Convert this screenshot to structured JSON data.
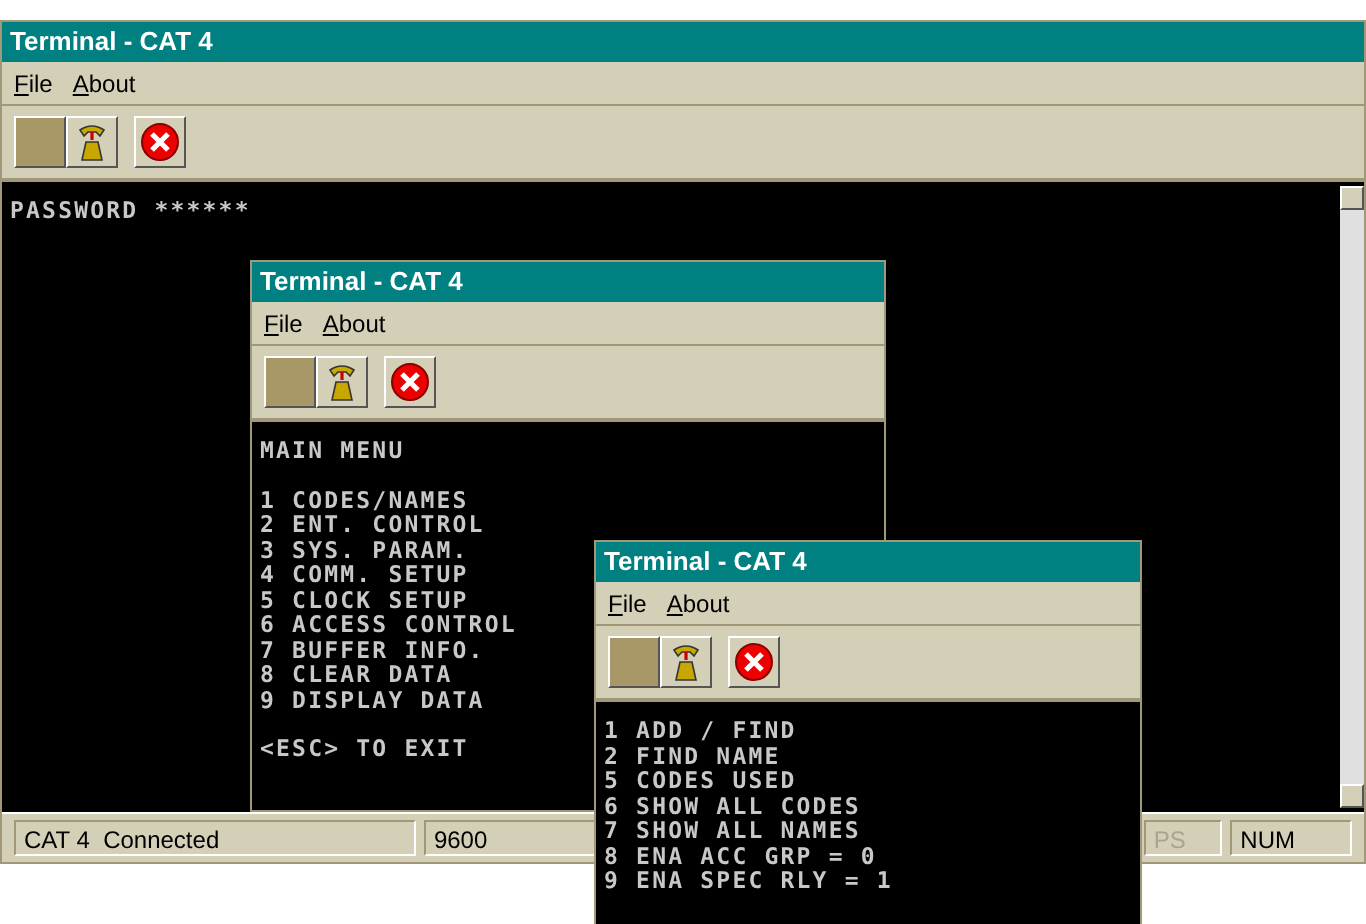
{
  "windows": [
    {
      "title": "Terminal - CAT 4",
      "menu": [
        "File",
        "About"
      ],
      "terminal": [
        [
          "PASSWORD ******"
        ]
      ],
      "status_bar": [
        {
          "text": "CAT 4  Connected",
          "disabled": false
        },
        {
          "text": "9600",
          "disabled": false
        },
        {
          "text": "PS",
          "disabled": true
        },
        {
          "text": "NUM",
          "disabled": false
        }
      ]
    },
    {
      "title": "Terminal - CAT 4",
      "menu": [
        "File",
        "About"
      ],
      "terminal": [
        [
          "MAIN MENU"
        ],
        [
          "1 CODES/NAMES",
          "2 ENT. CONTROL",
          "3 SYS. PARAM.",
          "4 COMM. SETUP",
          "5 CLOCK SETUP",
          "6 ACCESS CONTROL",
          "7 BUFFER INFO.",
          "8 CLEAR DATA",
          "9 DISPLAY DATA"
        ],
        [
          "<ESC> TO EXIT"
        ]
      ]
    },
    {
      "title": "Terminal - CAT 4",
      "menu": [
        "File",
        "About"
      ],
      "terminal": [
        [
          "1 ADD / FIND",
          "2 FIND NAME",
          "5 CODES USED",
          "6 SHOW ALL CODES",
          "7 SHOW ALL NAMES",
          "8 ENA ACC GRP = 0",
          "9 ENA SPEC RLY = 1"
        ]
      ]
    }
  ]
}
